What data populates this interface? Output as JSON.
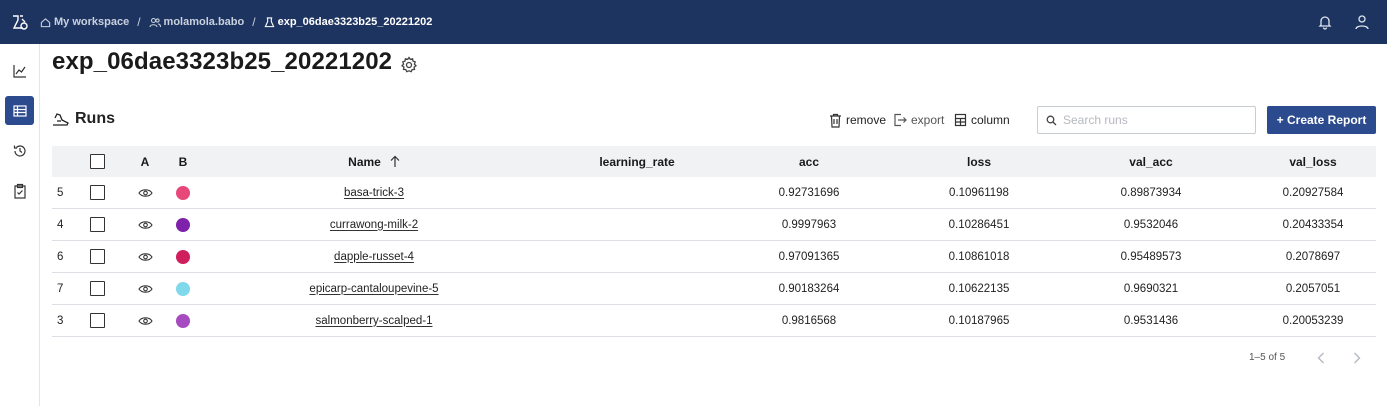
{
  "topbar": {
    "breadcrumb": {
      "workspace": "My workspace",
      "user": "molamola.babo",
      "experiment": "exp_06dae3323b25_20221202"
    }
  },
  "page": {
    "title": "exp_06dae3323b25_20221202"
  },
  "runs": {
    "heading": "Runs",
    "toolbar": {
      "remove_label": "remove",
      "export_label": "export",
      "column_label": "column"
    },
    "search": {
      "placeholder": "Search runs",
      "value": ""
    },
    "create_report_label": "+ Create Report",
    "columns": {
      "a": "A",
      "b": "B",
      "name": "Name",
      "learning_rate": "learning_rate",
      "acc": "acc",
      "loss": "loss",
      "val_acc": "val_acc",
      "val_loss": "val_loss"
    },
    "rows": [
      {
        "index": "5",
        "color": "#e8477a",
        "name": "basa-trick-3",
        "learning_rate": "",
        "acc": "0.92731696",
        "loss": "0.10961198",
        "val_acc": "0.89873934",
        "val_loss": "0.20927584"
      },
      {
        "index": "4",
        "color": "#7e22ab",
        "name": "currawong-milk-2",
        "learning_rate": "",
        "acc": "0.9997963",
        "loss": "0.10286451",
        "val_acc": "0.9532046",
        "val_loss": "0.20433354"
      },
      {
        "index": "6",
        "color": "#cf1f5c",
        "name": "dapple-russet-4",
        "learning_rate": "",
        "acc": "0.97091365",
        "loss": "0.10861018",
        "val_acc": "0.95489573",
        "val_loss": "0.2078697"
      },
      {
        "index": "7",
        "color": "#7fd9ea",
        "name": "epicarp-cantaloupevine-5",
        "learning_rate": "",
        "acc": "0.90183264",
        "loss": "0.10622135",
        "val_acc": "0.9690321",
        "val_loss": "0.2057051"
      },
      {
        "index": "3",
        "color": "#a74bc0",
        "name": "salmonberry-scalped-1",
        "learning_rate": "",
        "acc": "0.9816568",
        "loss": "0.10187965",
        "val_acc": "0.9531436",
        "val_loss": "0.20053239"
      }
    ],
    "pagination": {
      "label": "1–5 of 5"
    }
  },
  "theme": {
    "topbar_bg": "#1e3460",
    "accent": "#2c4a8e"
  },
  "icons": {
    "logo": "flask-logo-icon",
    "notifications": "bell-icon",
    "profile": "user-icon",
    "sidebar": [
      "chart-icon",
      "table-icon",
      "history-icon",
      "clipboard-icon"
    ]
  }
}
